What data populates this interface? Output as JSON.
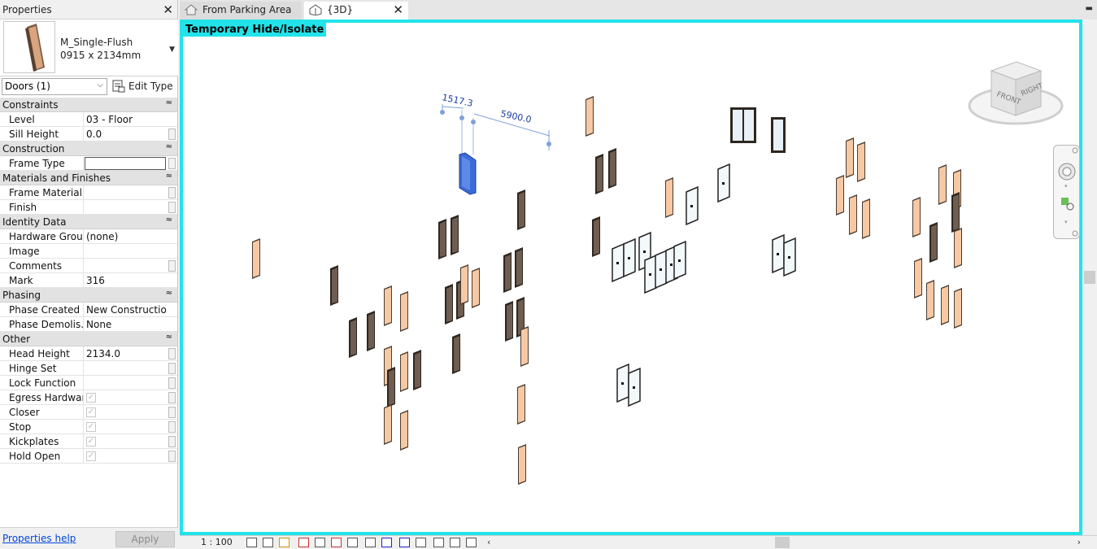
{
  "properties": {
    "title": "Properties",
    "type_name": "M_Single-Flush",
    "type_size": "0915 x 2134mm",
    "filter": "Doors (1)",
    "edit_type": "Edit Type",
    "groups": [
      {
        "name": "Constraints",
        "rows": [
          {
            "key": "Level",
            "value": "03 - Floor"
          },
          {
            "key": "Sill Height",
            "value": "0.0"
          }
        ]
      },
      {
        "name": "Construction",
        "rows": [
          {
            "key": "Frame Type",
            "value": ""
          }
        ]
      },
      {
        "name": "Materials and Finishes",
        "rows": [
          {
            "key": "Frame Material",
            "value": ""
          },
          {
            "key": "Finish",
            "value": ""
          }
        ]
      },
      {
        "name": "Identity Data",
        "rows": [
          {
            "key": "Hardware Group",
            "value": "(none)"
          },
          {
            "key": "Image",
            "value": ""
          },
          {
            "key": "Comments",
            "value": ""
          },
          {
            "key": "Mark",
            "value": "316"
          }
        ]
      },
      {
        "name": "Phasing",
        "rows": [
          {
            "key": "Phase Created",
            "value": "New Construction"
          },
          {
            "key": "Phase Demolis...",
            "value": "None"
          }
        ]
      },
      {
        "name": "Other",
        "rows": [
          {
            "key": "Head Height",
            "value": "2134.0"
          },
          {
            "key": "Hinge Set",
            "value": ""
          },
          {
            "key": "Lock Function",
            "value": ""
          },
          {
            "key": "Egress Hardware",
            "value": "checkbox"
          },
          {
            "key": "Closer",
            "value": "checkbox"
          },
          {
            "key": "Stop",
            "value": "checkbox"
          },
          {
            "key": "Kickplates",
            "value": "checkbox"
          },
          {
            "key": "Hold Open",
            "value": "checkbox"
          }
        ]
      }
    ],
    "help_link": "Properties help",
    "apply": "Apply"
  },
  "tabs": [
    {
      "label": "From Parking Area",
      "icon": "house-view-icon"
    },
    {
      "label": "{3D}",
      "icon": "3d-house-icon"
    }
  ],
  "view": {
    "mode_label": "Temporary Hide/Isolate",
    "dimension_1": "1517.3",
    "dimension_2": "5900.0",
    "viewcube_front": "FRONT",
    "viewcube_right": "RIGHT",
    "scale": "1 : 100",
    "colors": {
      "highlight": "#22e3ea",
      "selected": "#3b6bd6",
      "door_leaf": "#f6c9a4",
      "door_dark": "#6e5d50"
    }
  }
}
